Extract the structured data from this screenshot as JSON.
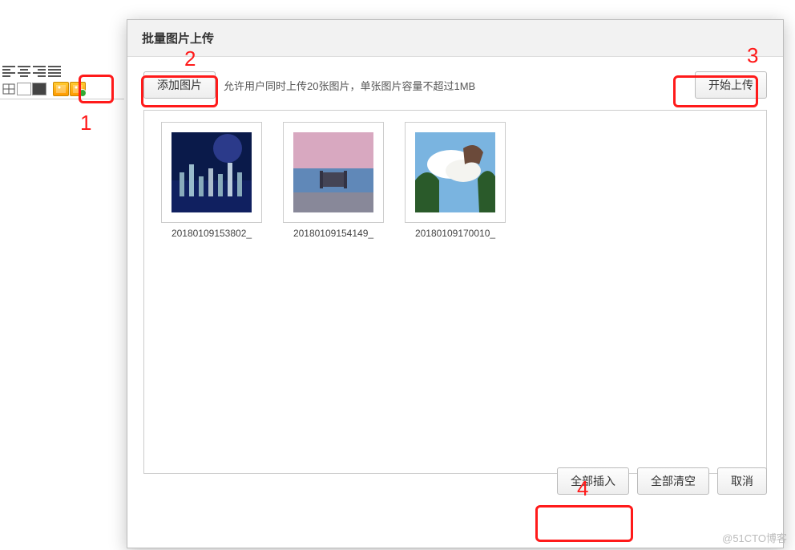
{
  "dialog": {
    "title": "批量图片上传",
    "add_button": "添加图片",
    "hint": "允许用户同时上传20张图片，单张图片容量不超过1MB",
    "start_button": "开始上传",
    "footer": {
      "insert_all": "全部插入",
      "clear_all": "全部清空",
      "cancel": "取消"
    }
  },
  "thumbnails": [
    {
      "name": "20180109153802_"
    },
    {
      "name": "20180109154149_"
    },
    {
      "name": "20180109170010_"
    }
  ],
  "annotations": {
    "n1": "1",
    "n2": "2",
    "n3": "3",
    "n4": "4"
  },
  "watermark": "@51CTO博客"
}
